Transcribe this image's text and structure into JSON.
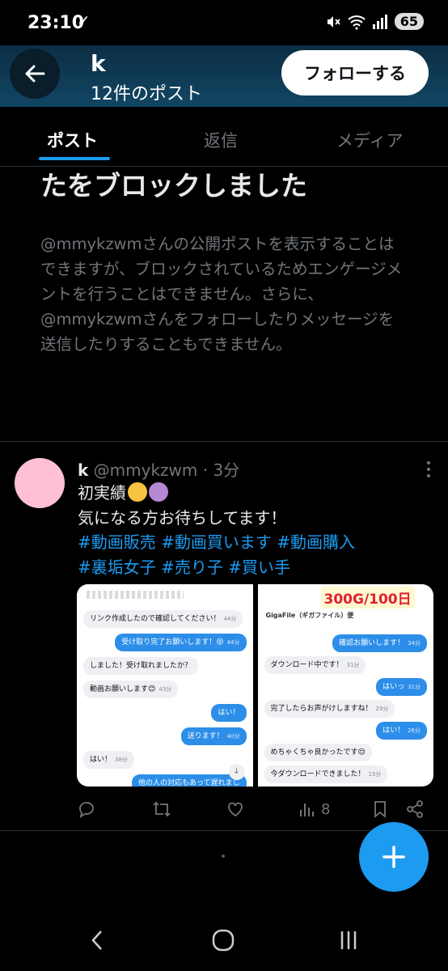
{
  "status_bar": {
    "time": "23:10",
    "check_icon": "check-icon",
    "battery": "65"
  },
  "header": {
    "name": "k",
    "post_count": "12件のポスト",
    "follow_label": "フォローする"
  },
  "tabs": [
    {
      "label": "ポスト",
      "active": true
    },
    {
      "label": "返信",
      "active": false
    },
    {
      "label": "メディア",
      "active": false
    }
  ],
  "block_notice": {
    "title_partial": "@mmykzwmさんはあな",
    "title_line2": "たをブロックしました",
    "description": "@mmykzwmさんの公開ポストを表示することはできますが、ブロックされているためエンゲージメントを行うことはできません。さらに、@mmykzwmさんをフォローしたりメッセージを送信したりすることもできません。"
  },
  "post": {
    "display_name": "k",
    "handle": "@mmykzwm",
    "time": "· 3分",
    "line1": "初実績",
    "line2": "気になる方お待ちしてます！",
    "hashtags_line1": "#動画販売 #動画買います #動画購入",
    "hashtags_line2": "#裏垢女子 #売り子 #買い手",
    "views": "8",
    "left_image_messages": [
      {
        "side": "in",
        "text": "リンク作成したので確認してください！",
        "time": "44分"
      },
      {
        "side": "out",
        "text": "受け取り完了お願いします！😝",
        "time": "44分"
      },
      {
        "side": "in",
        "text": "しました！受け取れましたか？",
        "time": ""
      },
      {
        "side": "in",
        "text": "動画お願いします😊",
        "time": "43分"
      },
      {
        "side": "out",
        "text": "はい！",
        "time": ""
      },
      {
        "side": "out",
        "text": "送ります！",
        "time": "40分"
      },
      {
        "side": "in",
        "text": "はい！",
        "time": "38分"
      },
      {
        "side": "out",
        "text": "他の人の対応もあって遅れまし",
        "time": ""
      }
    ],
    "right_image_banner": "300G/100日",
    "right_image_subtitle": "GigaFile（ギガファイル）便",
    "right_image_messages": [
      {
        "side": "out",
        "text": "確認お願いします！",
        "time": "34分"
      },
      {
        "side": "in",
        "text": "ダウンロード中です！",
        "time": "31分"
      },
      {
        "side": "out",
        "text": "はいっ",
        "time": "31分"
      },
      {
        "side": "in",
        "text": "完了したらお声がけしますね！",
        "time": "29分"
      },
      {
        "side": "out",
        "text": "はい！",
        "time": "26分"
      },
      {
        "side": "in",
        "text": "めちゃくちゃ良かったです😌",
        "time": ""
      },
      {
        "side": "in",
        "text": "今ダウンロードできました！",
        "time": "15分"
      }
    ]
  },
  "colors": {
    "accent": "#1d9bf0",
    "header_bg": "#124664",
    "avatar": "#ffc0d3"
  }
}
